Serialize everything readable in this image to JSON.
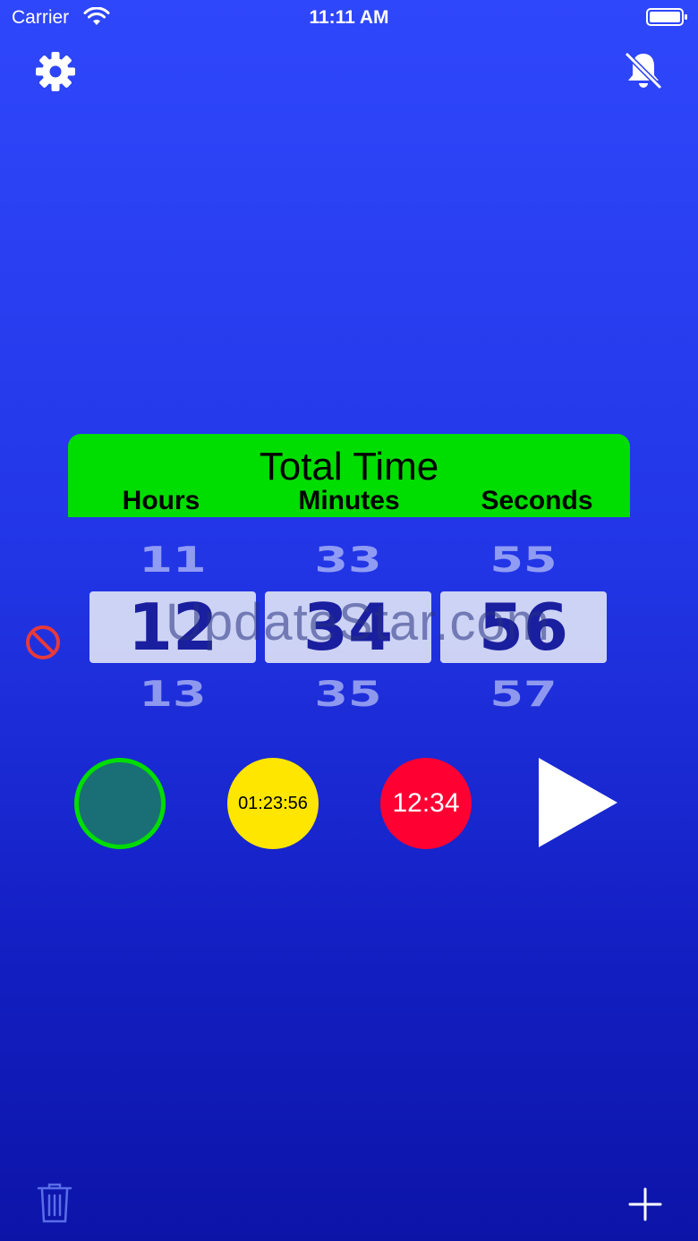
{
  "status_bar": {
    "carrier": "Carrier",
    "time": "11:11 AM"
  },
  "header": {
    "title": "Total Time",
    "columns": [
      "Hours",
      "Minutes",
      "Seconds"
    ]
  },
  "picker": {
    "hours": {
      "prev": "11",
      "value": "12",
      "next": "13"
    },
    "minutes": {
      "prev": "33",
      "value": "34",
      "next": "35"
    },
    "seconds": {
      "prev": "55",
      "value": "56",
      "next": "57"
    }
  },
  "watermark": "UpdateStar.com",
  "presets": [
    {
      "label": "01:23:56",
      "color": "#ffe600"
    },
    {
      "label": "12:34",
      "color": "#ff0033"
    }
  ],
  "colors": {
    "background_top": "#2f47fb",
    "background_bottom": "#0c14a8",
    "header_green": "#00dd00",
    "record_fill": "#1a6f77",
    "clear_red": "#e83a3a"
  },
  "icons": [
    "gear-icon",
    "bell-slash-icon",
    "clear-icon",
    "play-icon",
    "trash-icon",
    "plus-icon"
  ]
}
